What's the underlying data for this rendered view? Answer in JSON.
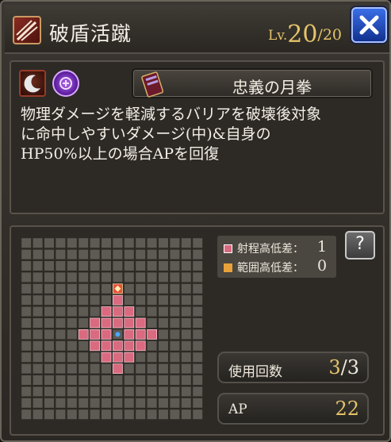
{
  "header": {
    "skill_name": "破盾活蹴",
    "level_prefix": "Lv.",
    "level_current": "20",
    "level_max": "/20",
    "icons": {
      "skill_type": "claw-slash-icon",
      "close": "close-x-icon"
    }
  },
  "skill_info": {
    "element_icon": "crescent-moon-element-icon",
    "type_icon": "purple-orb-type-icon",
    "weapon_icon": "book-tome-icon",
    "weapon_name": "忠義の月拳",
    "description_lines": [
      "物理ダメージを軽減するバリアを破壊後対象",
      "に命中しやすいダメージ(中)&自身の",
      "HP50%以上の場合APを回復"
    ]
  },
  "range": {
    "range_height_label": "射程高低差：",
    "range_height_value": "1",
    "area_height_label": "範囲高低差：",
    "area_height_value": "0",
    "help_label": "?",
    "colors": {
      "range": "#d96a7f",
      "area": "#e8a23a",
      "target": "#e8503a",
      "center": "#4aa8ff",
      "grid": "#5e5a54"
    }
  },
  "stats": {
    "uses_label": "使用回数",
    "uses_current": "3",
    "uses_slash": "/",
    "uses_total": "3",
    "ap_label": "AP",
    "ap_value": "22"
  }
}
